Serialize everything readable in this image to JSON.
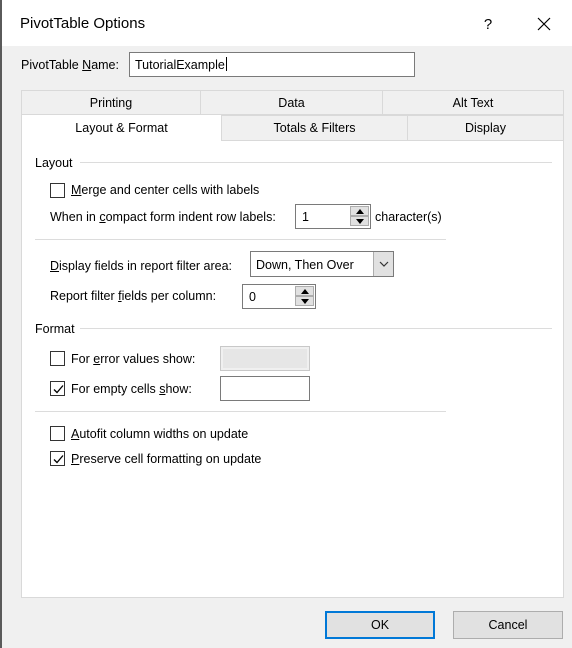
{
  "dialog": {
    "title": "PivotTable Options",
    "help_symbol": "?",
    "name_label_prefix": "PivotTable ",
    "name_label_underlined": "N",
    "name_label_suffix": "ame:",
    "name_value": "TutorialExample"
  },
  "tabs": {
    "row1": [
      "Printing",
      "Data",
      "Alt Text"
    ],
    "row2": [
      "Layout & Format",
      "Totals & Filters",
      "Display"
    ],
    "active": "Layout & Format"
  },
  "layout_section": {
    "title": "Layout",
    "merge": {
      "underlined": "M",
      "rest": "erge and center cells with labels",
      "checked": false
    },
    "indent": {
      "before": "When in ",
      "underlined": "c",
      "after": "ompact form indent row labels:",
      "value": "1",
      "unit": "character(s)"
    },
    "display_fields": {
      "underlined": "D",
      "rest": "isplay fields in report filter area:",
      "selected": "Down, Then Over"
    },
    "filter_fields": {
      "before": "Report filter ",
      "underlined": "f",
      "after": "ields per column:",
      "value": "0"
    }
  },
  "format_section": {
    "title": "Format",
    "error_values": {
      "before": "For ",
      "underlined": "e",
      "after": "rror values show:",
      "checked": false,
      "value": ""
    },
    "empty_cells": {
      "before": "For empty cells ",
      "underlined": "s",
      "after": "how:",
      "checked": true,
      "value": ""
    },
    "autofit": {
      "underlined": "A",
      "rest": "utofit column widths on update",
      "checked": false
    },
    "preserve": {
      "underlined": "P",
      "rest": "reserve cell formatting on update",
      "checked": true
    }
  },
  "buttons": {
    "ok": "OK",
    "cancel": "Cancel"
  },
  "colors": {
    "default_button_border": "#0078d7",
    "dialog_bg": "#f0f0f0",
    "panel_bg": "#ffffff"
  }
}
